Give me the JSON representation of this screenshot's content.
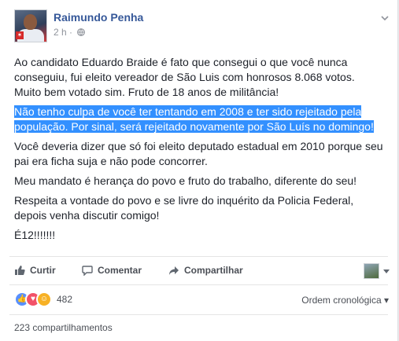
{
  "post": {
    "author": "Raimundo Penha",
    "time": "2 h",
    "separator": "·",
    "paragraphs": {
      "p1": "Ao candidato Eduardo Braide é fato que consegui o que você nunca conseguiu, fui eleito vereador de São Luis com honrosos 8.068 votos. Muito bem votado sim. Fruto de 18 anos de militância!",
      "p2": "Não tenho culpa de você ter tentando em 2008 e ter sido rejeitado pela população. Por sinal, será rejeitado novamente por São Luís no domingo!",
      "p3": "Você deveria dizer que só foi eleito deputado estadual em 2010 porque seu pai era ficha suja e não pode concorrer.",
      "p4": "Meu mandato é herança do povo e fruto do trabalho, diferente do seu!",
      "p5": "Respeita a vontade do povo e se livre do inquérito da Policia Federal, depois venha discutir comigo!",
      "p6": "É12!!!!!!!"
    }
  },
  "actions": {
    "like": "Curtir",
    "comment": "Comentar",
    "share": "Compartilhar"
  },
  "reactions": {
    "icons": [
      "like-icon",
      "love-icon",
      "haha-icon"
    ],
    "count": "482",
    "order": "Ordem cronológica"
  },
  "shares": "223 compartilhamentos",
  "colors": {
    "link": "#365899",
    "highlight": "#3390ff",
    "like": "#5890ff",
    "love": "#f25268",
    "haha": "#f7b125"
  }
}
